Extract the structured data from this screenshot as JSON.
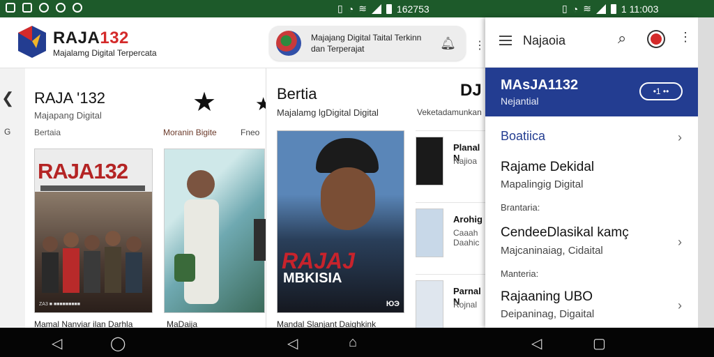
{
  "status_bar": {
    "left_time": "162753",
    "right_time": "1 11:003"
  },
  "app": {
    "brand_prefix": "RAJA",
    "brand_accent": "132",
    "tagline": "Majalamg Digital Terpercata",
    "notification_text": "Majajang Digital Taital Terkinn dan Terperajat"
  },
  "left_edge": {
    "letter": "G"
  },
  "column1": {
    "title": "RAJA '132",
    "subtitle": "Majapang Digital",
    "kicker": "Bertaia",
    "more_label": "Moranin Bigite",
    "more_label2": "Fneo",
    "poster_title": "RAJA132",
    "poster_footer": "ZA3 ■ ■■■■■■■■■",
    "caption1": "Mamal Nanviar ilan Darhla",
    "caption2": "MaDaija"
  },
  "column2": {
    "title": "Bertia",
    "subtitle": "Majalamg lgDigital Digital",
    "corner_label": "DJ",
    "more_label": "Veketadamunkan",
    "poster_title": "RAJAJ",
    "poster_subtitle": "MBKISIA",
    "poster_badge": "ЮЭ",
    "caption": "Mandal Slanjant Daighkink",
    "list": [
      {
        "title": "Planal N",
        "subtitle": "Najioa"
      },
      {
        "title": "Arohig",
        "subtitle": "Caaah Daahic"
      },
      {
        "title": "Parnal N",
        "subtitle": "Rojnal"
      }
    ]
  },
  "drawer": {
    "title": "Najaoia",
    "hero_title": "MAsJA1132",
    "hero_subtitle": "Nejantial",
    "hero_pill": "•1 ••",
    "section_label": "Boatiica",
    "items": [
      {
        "title": "Rajame Dekidal",
        "subtitle": "Mapalingig Digital",
        "label": "Brantaria:"
      },
      {
        "title": "CendeeDlasikal kamç",
        "subtitle": "Majcaninaiag, Cidaital",
        "label": "Manteria:"
      },
      {
        "title": "Rajaaning UBO",
        "subtitle": "Deipaninag, Digaital",
        "label": ""
      }
    ]
  },
  "colors": {
    "status_bar": "#1d5a2a",
    "brand_red": "#d42a2a",
    "hero_blue": "#233d91",
    "nav_bar": "#050505"
  },
  "icons": {
    "nav": [
      "back-icon",
      "home-icon",
      "back-icon",
      "home-icon",
      "back-icon",
      "recents-icon"
    ]
  }
}
